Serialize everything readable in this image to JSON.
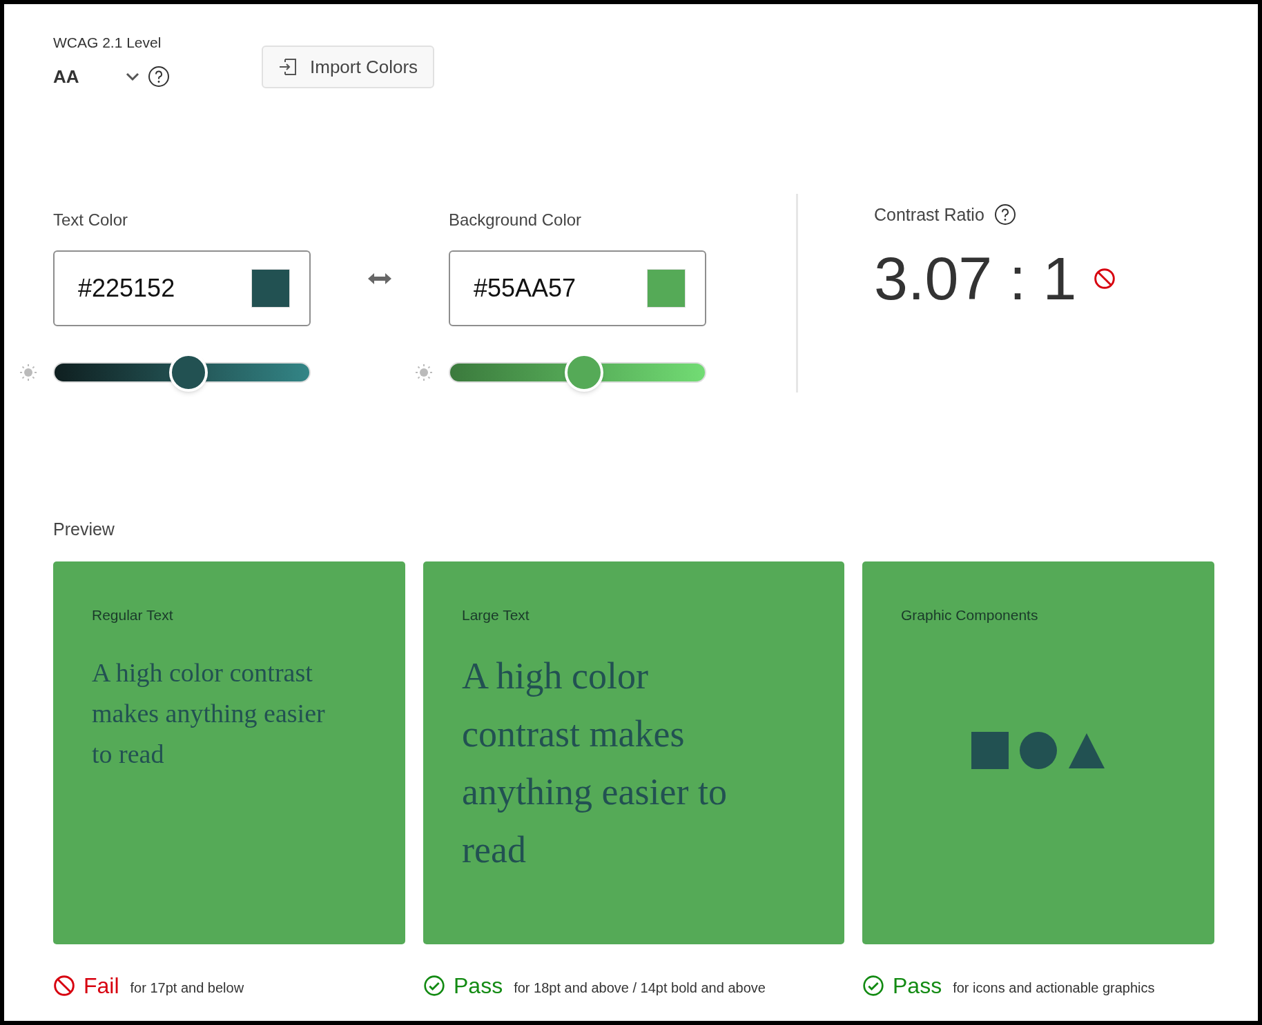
{
  "level_picker": {
    "label": "WCAG 2.1 Level",
    "value": "AA"
  },
  "import_button": {
    "label": "Import Colors"
  },
  "colors": [
    {
      "label": "Text Color",
      "value": "#225152",
      "color": "#225152",
      "level": 0.53
    },
    {
      "label": "Background Color",
      "value": "#55AA57",
      "color": "#55aa57",
      "level": 0.53
    }
  ],
  "contrast": {
    "label": "Contrast Ratio",
    "value": "3.07 : 1",
    "passed": false
  },
  "preview": {
    "label": "Preview",
    "cards": [
      {
        "kind": "regular",
        "title": "Regular Text",
        "text": "A high color contrast makes anything easier to read"
      },
      {
        "kind": "large",
        "title": "Large Text",
        "text": "A high color contrast makes anything easier to read"
      },
      {
        "kind": "graphic",
        "title": "Graphic Components"
      }
    ]
  },
  "results": [
    {
      "passed": false,
      "label": "Fail",
      "note": "for 17pt and below"
    },
    {
      "passed": true,
      "label": "Pass",
      "note": "for 18pt and above / 14pt bold and above"
    },
    {
      "passed": true,
      "label": "Pass",
      "note": "for icons and actionable graphics"
    }
  ]
}
